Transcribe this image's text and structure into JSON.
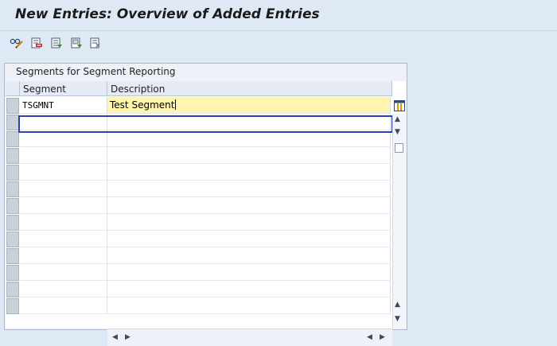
{
  "title": "New Entries: Overview of Added Entries",
  "toolbar": {
    "buttons": [
      {
        "name": "display-change-icon"
      },
      {
        "name": "delete-icon"
      },
      {
        "name": "select-all-icon"
      },
      {
        "name": "select-block-icon"
      },
      {
        "name": "deselect-all-icon"
      }
    ]
  },
  "panel": {
    "title": "Segments for Segment Reporting",
    "columns": [
      "Segment",
      "Description"
    ],
    "rows": [
      {
        "segment": "TSGMNT",
        "description": "Test Segment"
      }
    ],
    "empty_rows": 12
  },
  "colors": {
    "active_outline": "#2f3fb0",
    "edit_cell_bg": "#fff5b0",
    "page_bg": "#dfe9f5"
  }
}
